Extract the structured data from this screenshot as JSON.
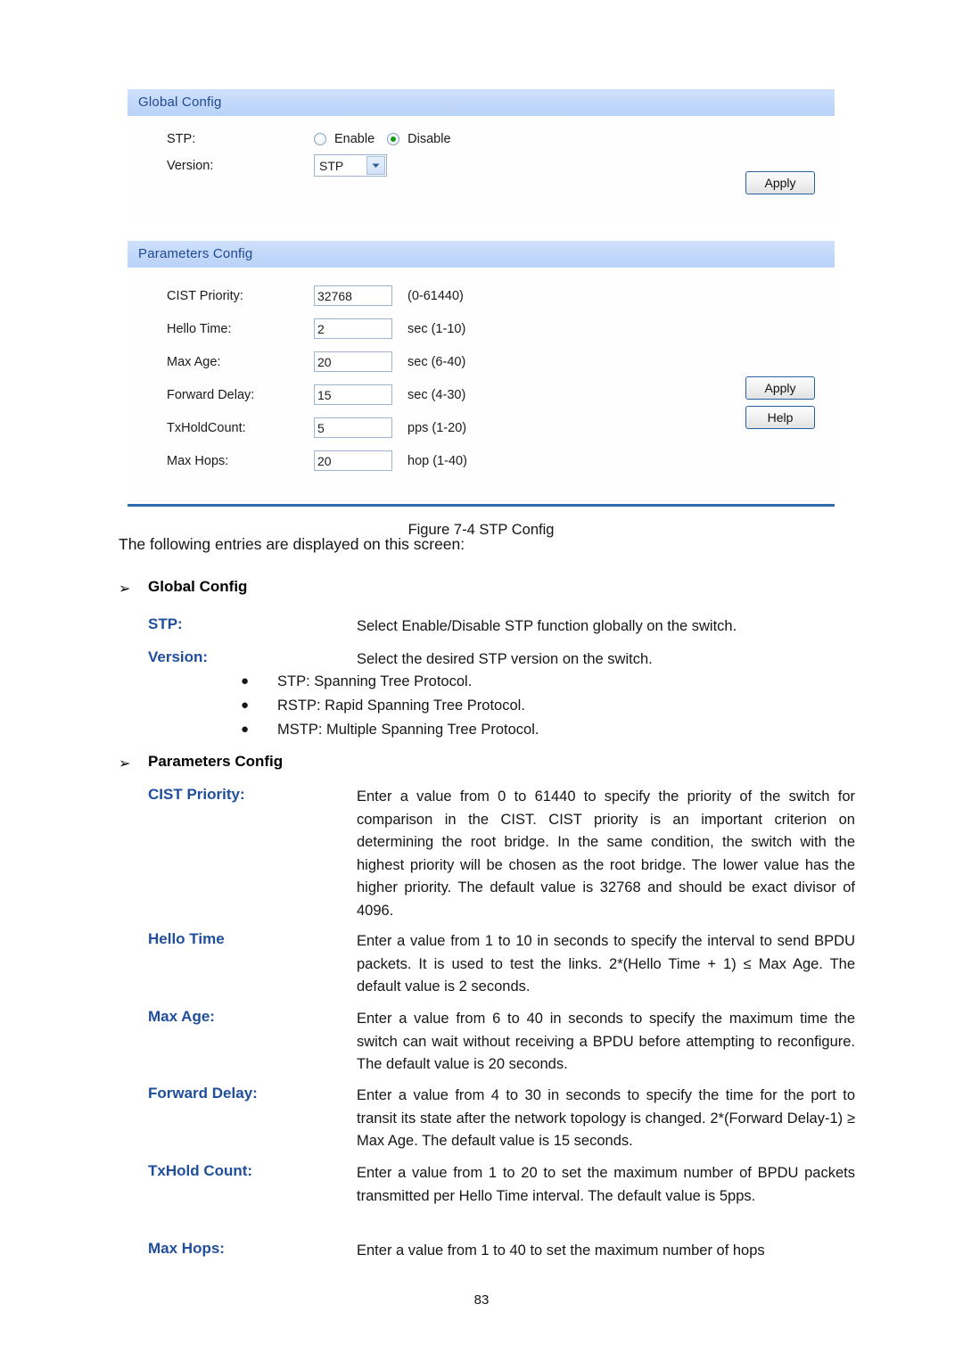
{
  "figure": {
    "global_config": {
      "header": "Global Config",
      "stp_label": "STP:",
      "radio_enable": "Enable",
      "radio_disable": "Disable",
      "selected_radio": "Disable",
      "version_label": "Version:",
      "version_value": "STP",
      "version_options": [
        "STP",
        "RSTP",
        "MSTP"
      ],
      "apply_label": "Apply"
    },
    "parameters_config": {
      "header": "Parameters Config",
      "rows": [
        {
          "label": "CIST Priority:",
          "value": "32768",
          "hint": "(0-61440)"
        },
        {
          "label": "Hello Time:",
          "value": "2",
          "hint": "sec (1-10)"
        },
        {
          "label": "Max Age:",
          "value": "20",
          "hint": "sec (6-40)"
        },
        {
          "label": "Forward Delay:",
          "value": "15",
          "hint": "sec (4-30)"
        },
        {
          "label": "TxHoldCount:",
          "value": "5",
          "hint": "pps (1-20)"
        },
        {
          "label": "Max Hops:",
          "value": "20",
          "hint": "hop (1-40)"
        }
      ],
      "apply_label": "Apply",
      "help_label": "Help"
    },
    "caption": "Figure 7-4 STP Config",
    "accent_header_text_color": "#21498f",
    "accent_header_bg_color": "#c2d8fa",
    "accent_rule_color": "#2b6cad",
    "radio_selected_color": "#159b16"
  },
  "document": {
    "intro": "The following entries are displayed on this screen:",
    "section1": {
      "arrow_glyph": "➢",
      "title": "Global Config",
      "entries": [
        {
          "term": "STP:",
          "desc": "Select Enable/Disable STP function globally on the switch."
        },
        {
          "term": "Version:",
          "desc": "Select the desired STP version on the switch.",
          "bullets": [
            "STP: Spanning Tree Protocol.",
            "RSTP: Rapid Spanning Tree Protocol.",
            "MSTP: Multiple Spanning Tree Protocol."
          ],
          "bullet_glyph": "●"
        }
      ]
    },
    "section2": {
      "arrow_glyph": "➢",
      "title": "Parameters Config",
      "entries": [
        {
          "term": "CIST Priority:",
          "desc": "Enter a value from 0 to 61440 to specify the priority of the switch for comparison in the CIST. CIST priority is an important criterion on determining the root bridge. In the same condition, the switch with the highest priority will be chosen as the root bridge. The lower value has the higher priority. The default value is 32768 and should be exact divisor of 4096."
        },
        {
          "term": "Hello Time",
          "desc": "Enter a value from 1 to 10 in seconds to specify the interval to send BPDU packets. It is used to test the links. 2*(Hello Time + 1) ≤ Max Age. The default value is 2 seconds."
        },
        {
          "term": "Max Age:",
          "desc": "Enter a value from 6 to 40 in seconds to specify the maximum time the switch can wait without receiving a BPDU before attempting to reconfigure. The default value is 20 seconds."
        },
        {
          "term": "Forward Delay:",
          "desc": "Enter a value from 4 to 30 in seconds to specify the time for the port to transit its state after the network topology is changed. 2*(Forward Delay-1) ≥ Max Age. The default value is 15 seconds."
        },
        {
          "term": "TxHold Count:",
          "desc": "Enter a value from 1 to 20 to set the maximum number of BPDU packets transmitted per Hello Time interval. The default value is 5pps."
        },
        {
          "term": "Max Hops:",
          "desc": "Enter a value from 1 to 40 to set the maximum number of hops"
        }
      ],
      "term_color": "#1f4e9c"
    },
    "page_number": "83"
  }
}
